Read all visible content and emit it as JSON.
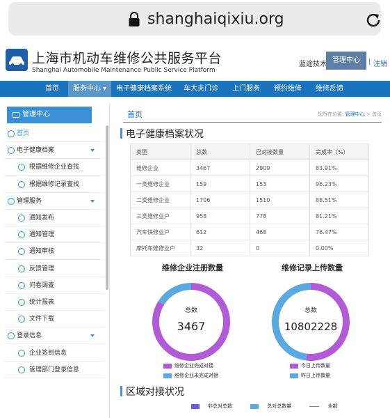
{
  "browser": {
    "url": "shanghaiqixiu.org"
  },
  "header": {
    "title_cn": "上海市机动车维修公共服务平台",
    "title_en": "Shanghai Automobile Maintenance Public Service Platform",
    "tech_link": "蓝途技术",
    "admin_button": "管理中心",
    "separator": "|",
    "logout": "注销"
  },
  "nav": {
    "items": [
      "首页",
      "服务中心",
      "电子健康档案系统",
      "车大夫门诊",
      "上门服务",
      "预约维修",
      "维修反馈"
    ],
    "dropdown_marker": "▾"
  },
  "sidebar": {
    "header": "管理中心",
    "items": [
      {
        "label": "首页",
        "level": 0
      },
      {
        "label": "电子健康档案",
        "level": 0,
        "expandable": true
      },
      {
        "label": "根据维修企业查找",
        "level": 1
      },
      {
        "label": "根据维修记录查找",
        "level": 1
      },
      {
        "label": "管理服务",
        "level": 0,
        "expandable": true
      },
      {
        "label": "通知发布",
        "level": 1
      },
      {
        "label": "通知管理",
        "level": 1
      },
      {
        "label": "通知审核",
        "level": 1
      },
      {
        "label": "反馈管理",
        "level": 1
      },
      {
        "label": "问卷调查",
        "level": 1
      },
      {
        "label": "统计报表",
        "level": 1
      },
      {
        "label": "文件下载",
        "level": 1
      },
      {
        "label": "登录信息",
        "level": 0,
        "expandable": true
      },
      {
        "label": "企业签到信息",
        "level": 1
      },
      {
        "label": "管理部门登录信息",
        "level": 1
      }
    ]
  },
  "main": {
    "tab": "首页",
    "breadcrumb_prefix": "您所在位置:",
    "breadcrumb_link": "管理中心",
    "breadcrumb_sep": ">",
    "breadcrumb_current": "首页",
    "section1_title": "电子健康档案状况",
    "table": {
      "headers": [
        "类型",
        "总数",
        "已对接数量",
        "完成率（%）"
      ],
      "rows": [
        [
          "维修企业",
          "3467",
          "2909",
          "83.91%"
        ],
        [
          "一类维修企业",
          "159",
          "153",
          "96.23%"
        ],
        [
          "二类维修企业",
          "1706",
          "1510",
          "88.51%"
        ],
        [
          "三类维修业户",
          "958",
          "778",
          "81.21%"
        ],
        [
          "汽车快修业户",
          "612",
          "468",
          "76.47%"
        ],
        [
          "摩托车维修业户",
          "32",
          "0",
          "0.00%"
        ]
      ]
    },
    "section2_title": "区域对接状况"
  },
  "chart_data": [
    {
      "type": "pie",
      "title": "维修企业注册数量",
      "center_label": "总数",
      "center_value": "3467",
      "series": [
        {
          "name": "维修企业完成对接",
          "value": 2909,
          "color": "#b25bd6"
        },
        {
          "name": "维修企业未完成对接",
          "value": 558,
          "color": "#5aa9e0"
        }
      ]
    },
    {
      "type": "pie",
      "title": "维修记录上传数量",
      "center_label": "总数",
      "center_value": "10802228",
      "series": [
        {
          "name": "今日上传数量",
          "value": 0.52,
          "color": "#b25bd6"
        },
        {
          "name": "昨日上传数量",
          "value": 0.48,
          "color": "#5aa9e0"
        }
      ]
    },
    {
      "type": "bar",
      "title": "区域对接状况",
      "series": [
        {
          "name": "非总对总数",
          "color": "#6a5fd6"
        },
        {
          "name": "总对总数量",
          "color": "#5aa9e0"
        },
        {
          "name": "全部",
          "color": "#b25bd6"
        }
      ]
    }
  ],
  "colors": {
    "nav": "#1b73bd",
    "accent": "#3b8fd6",
    "purple": "#b25bd6",
    "blue": "#5aa9e0"
  }
}
